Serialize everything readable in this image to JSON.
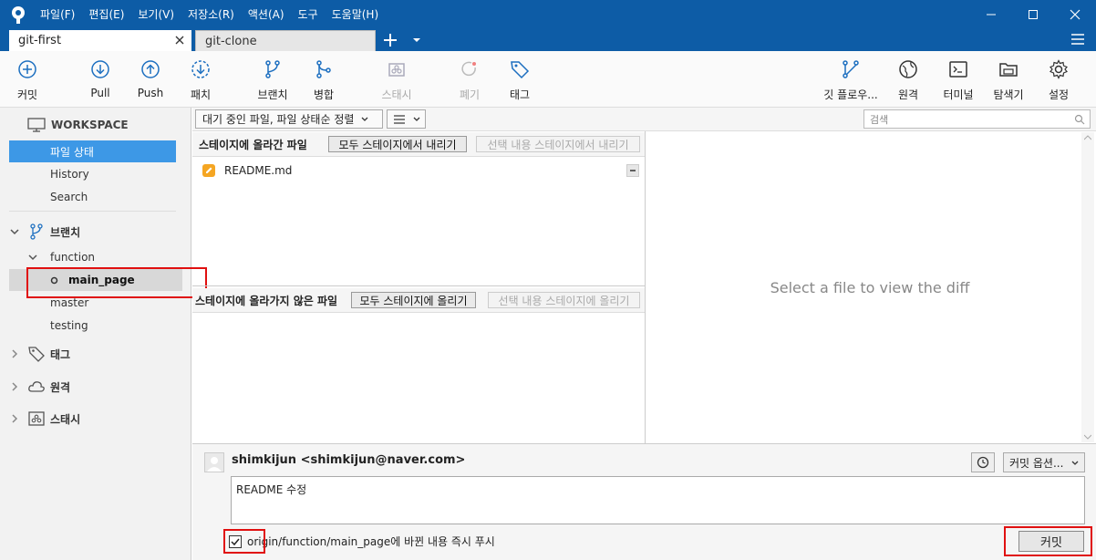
{
  "menu": [
    "파일(F)",
    "편집(E)",
    "보기(V)",
    "저장소(R)",
    "액션(A)",
    "도구",
    "도움말(H)"
  ],
  "tabs": [
    {
      "label": "git-first",
      "active": true
    },
    {
      "label": "git-clone",
      "active": false
    }
  ],
  "toolbar": {
    "commit": "커밋",
    "pull": "Pull",
    "push": "Push",
    "fetch": "패치",
    "branch": "브랜치",
    "merge": "병합",
    "stash": "스태시",
    "discard": "폐기",
    "tag": "태그",
    "git_flow": "깃 플로우...",
    "remote": "원격",
    "terminal": "터미널",
    "explorer": "탐색기",
    "settings": "설정"
  },
  "sidebar": {
    "workspace_title": "WORKSPACE",
    "workspace_items": [
      "파일 상태",
      "History",
      "Search"
    ],
    "branches_title": "브랜치",
    "branch_folder": "function",
    "branch_current": "main_page",
    "branches": [
      "master",
      "testing"
    ],
    "tags_title": "태그",
    "remotes_title": "원격",
    "stashes_title": "스태시"
  },
  "filter": {
    "sort_label": "대기 중인 파일, 파일 상태순 정렬",
    "search_placeholder": "검색"
  },
  "staged": {
    "title": "스테이지에 올라간 파일",
    "unstage_all": "모두 스테이지에서 내리기",
    "unstage_selected": "선택 내용 스테이지에서 내리기",
    "files": [
      "README.md"
    ]
  },
  "unstaged": {
    "title": "스테이지에 올라가지 않은 파일",
    "stage_all": "모두 스테이지에 올리기",
    "stage_selected": "선택 내용 스테이지에 올리기"
  },
  "diff": {
    "empty_message": "Select a file to view the diff"
  },
  "commit": {
    "author": "shimkijun <shimkijun@naver.com>",
    "options_label": "커밋 옵션...",
    "message": "README 수정",
    "push_label": "origin/function/main_page에 바뀐 내용 즉시 푸시",
    "push_checked": true,
    "button_label": "커밋"
  },
  "colors": {
    "titlebar": "#0d5ca6",
    "selection": "#3d98e6",
    "highlight": "#e01010",
    "icon_blue": "#1d6fc0"
  }
}
